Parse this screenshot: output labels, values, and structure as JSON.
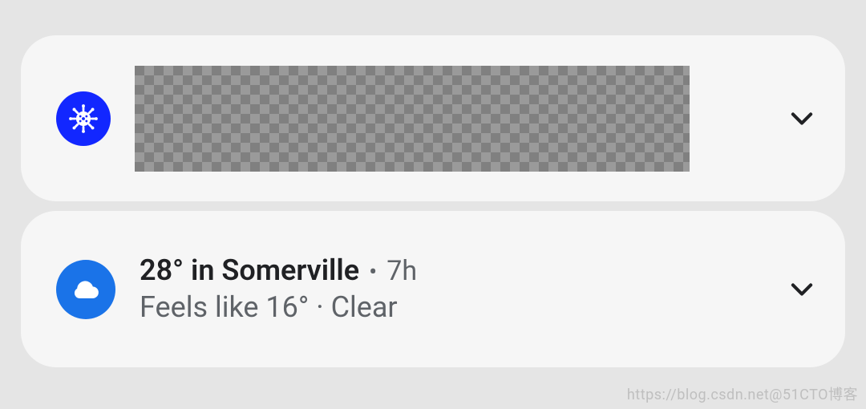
{
  "cards": {
    "covid": {
      "icon": "virus-icon",
      "icon_color": "#1227ff",
      "content_redacted": true
    },
    "weather": {
      "icon": "cloud-icon",
      "icon_color": "#1a73e8",
      "title": "28° in Somerville",
      "separator": "•",
      "age": "7h",
      "subtitle": "Feels like 16° · Clear"
    }
  },
  "watermark": "https://blog.csdn.net@51CTO博客"
}
